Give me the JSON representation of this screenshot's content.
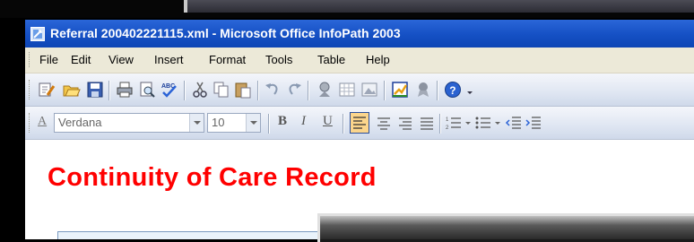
{
  "window": {
    "title": "Referral 200402221115.xml - Microsoft Office InfoPath 2003"
  },
  "menu": {
    "items": [
      "File",
      "Edit",
      "View",
      "Insert",
      "Format",
      "Tools",
      "Table",
      "Help"
    ]
  },
  "standard_toolbar": {
    "buttons": [
      "design-icon",
      "open-icon",
      "save-icon",
      "print-icon",
      "print-preview-icon",
      "spelling-icon",
      "cut-icon",
      "copy-icon",
      "paste-icon",
      "undo-icon",
      "redo-icon",
      "digital-signature-icon",
      "table-icon",
      "picture-icon",
      "design-task-pane-icon",
      "sign-icon",
      "help-icon"
    ]
  },
  "formatting_toolbar": {
    "font_name": "Verdana",
    "font_size": "10",
    "bold_label": "B",
    "italic_label": "I",
    "underline_label": "U",
    "style_label": "A"
  },
  "document": {
    "title": "Continuity of Care Record"
  },
  "colors": {
    "titlebar": "#1550c4",
    "doc_title": "#ff0000"
  }
}
